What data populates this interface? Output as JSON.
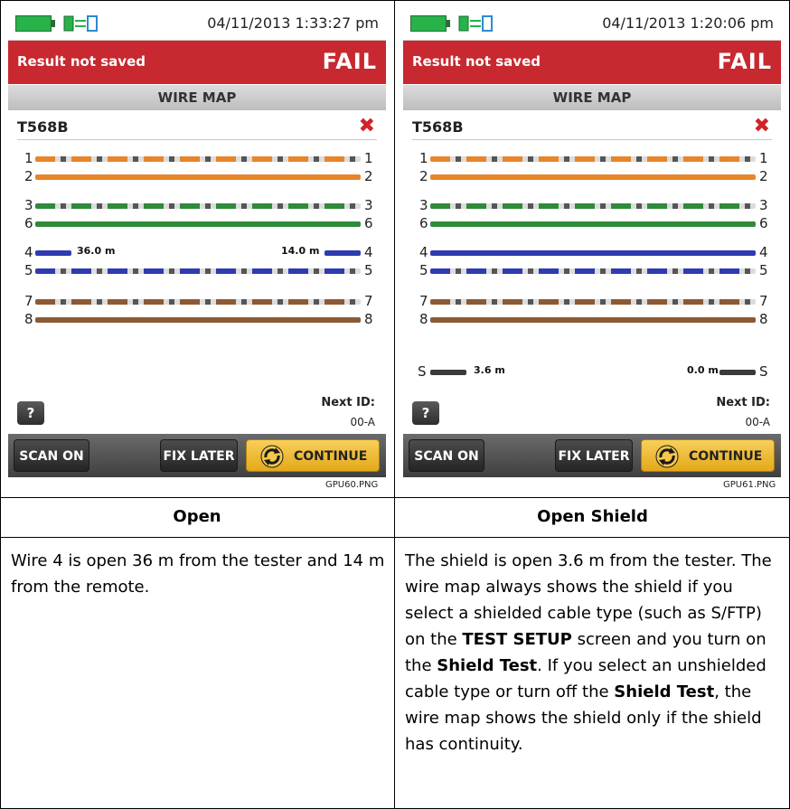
{
  "panels": [
    {
      "status": {
        "datetime": "04/11/2013 1:33:27 pm"
      },
      "result": {
        "message": "Result not saved",
        "status": "FAIL"
      },
      "title": "WIRE MAP",
      "standard": "T568B",
      "next_id_label": "Next ID:",
      "next_id_value": "00-A",
      "labels": {
        "wire4_left": "36.0 m",
        "wire4_right": "14.0 m"
      },
      "buttons": {
        "help": "?",
        "scan": "SCAN ON",
        "fix": "FIX LATER",
        "continue": "CONTINUE"
      },
      "caption": "GPU60.PNG",
      "heading": "Open",
      "description": "Wire 4 is open 36 m from the tester and 14 m from the remote."
    },
    {
      "status": {
        "datetime": "04/11/2013 1:20:06 pm"
      },
      "result": {
        "message": "Result not saved",
        "status": "FAIL"
      },
      "title": "WIRE MAP",
      "standard": "T568B",
      "next_id_label": "Next ID:",
      "next_id_value": "00-A",
      "labels": {
        "shield_left": "3.6 m",
        "shield_right": "0.0 m"
      },
      "buttons": {
        "help": "?",
        "scan": "SCAN ON",
        "fix": "FIX LATER",
        "continue": "CONTINUE"
      },
      "caption": "GPU61.PNG",
      "heading": "Open Shield",
      "description": {
        "p1": "The shield is open 3.6 m from the tester. The wire map always shows the shield if you select a shielded cable type (such as S/FTP) on the ",
        "b1": "TEST SETUP",
        "p2": " screen and you turn on the ",
        "b2": "Shield Test",
        "p3": ". If you select an unshielded cable type or turn off the ",
        "b3": "Shield Test",
        "p4": ", the wire map shows the shield only if the shield has continuity."
      }
    }
  ],
  "pins": {
    "p1": "1",
    "p2": "2",
    "p3": "3",
    "p6": "6",
    "p4": "4",
    "p5": "5",
    "p7": "7",
    "p8": "8",
    "ps": "S"
  },
  "colors": {
    "orange": "#e8852a",
    "green": "#2f8a3a",
    "blue": "#2f3bb0",
    "brown": "#8b5a34",
    "shield": "#3a3a3a",
    "fail_red": "#c8282f",
    "continue_yellow": "#f2c13c"
  }
}
